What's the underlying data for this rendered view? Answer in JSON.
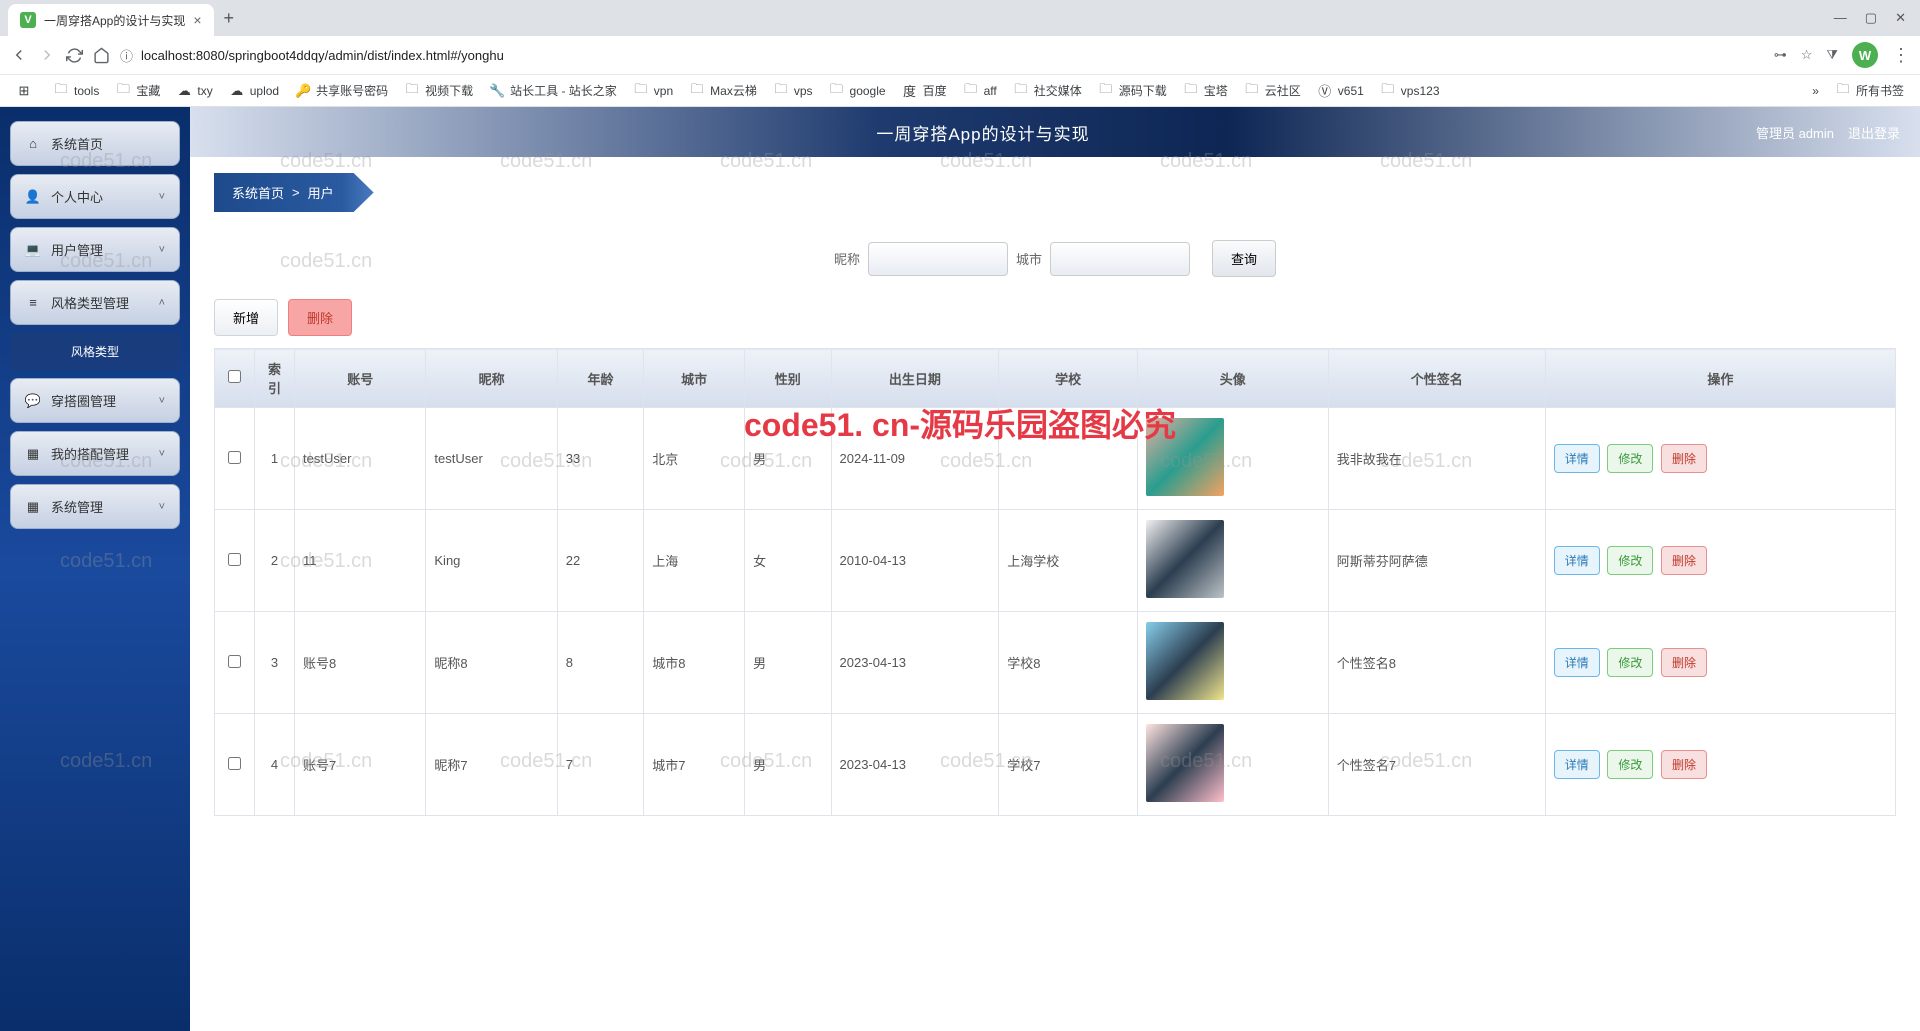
{
  "browser": {
    "tab_title": "一周穿搭App的设计与实现",
    "url": "localhost:8080/springboot4ddqy/admin/dist/index.html#/yonghu",
    "avatar_letter": "W",
    "all_bookmarks": "所有书签",
    "bookmarks": [
      {
        "icon": "apps",
        "label": ""
      },
      {
        "icon": "folder",
        "label": "tools"
      },
      {
        "icon": "folder",
        "label": "宝藏"
      },
      {
        "icon": "cloud",
        "label": "txy"
      },
      {
        "icon": "cloud",
        "label": "uplod"
      },
      {
        "icon": "key",
        "label": "共享账号密码"
      },
      {
        "icon": "folder",
        "label": "视频下载"
      },
      {
        "icon": "tool",
        "label": "站长工具 - 站长之家"
      },
      {
        "icon": "folder",
        "label": "vpn"
      },
      {
        "icon": "folder",
        "label": "Max云梯"
      },
      {
        "icon": "folder",
        "label": "vps"
      },
      {
        "icon": "folder",
        "label": "google"
      },
      {
        "icon": "baidu",
        "label": "百度"
      },
      {
        "icon": "folder",
        "label": "aff"
      },
      {
        "icon": "folder",
        "label": "社交媒体"
      },
      {
        "icon": "folder",
        "label": "源码下载"
      },
      {
        "icon": "folder",
        "label": "宝塔"
      },
      {
        "icon": "folder",
        "label": "云社区"
      },
      {
        "icon": "v",
        "label": "v651"
      },
      {
        "icon": "folder",
        "label": "vps123"
      }
    ]
  },
  "header": {
    "title": "一周穿搭App的设计与实现",
    "admin_label": "管理员 admin",
    "logout_label": "退出登录"
  },
  "sidebar": {
    "items": [
      {
        "icon": "home",
        "label": "系统首页",
        "expandable": false
      },
      {
        "icon": "person",
        "label": "个人中心",
        "expandable": true
      },
      {
        "icon": "laptop",
        "label": "用户管理",
        "expandable": true
      },
      {
        "icon": "style",
        "label": "风格类型管理",
        "expandable": true,
        "expanded": true
      },
      {
        "icon": "chat",
        "label": "穿搭圈管理",
        "expandable": true
      },
      {
        "icon": "grid",
        "label": "我的搭配管理",
        "expandable": true
      },
      {
        "icon": "grid",
        "label": "系统管理",
        "expandable": true
      }
    ],
    "submenu_label": "风格类型"
  },
  "breadcrumb": {
    "home": "系统首页",
    "current": "用户"
  },
  "filter": {
    "nickname_label": "昵称",
    "city_label": "城市",
    "query_label": "查询"
  },
  "actions": {
    "add_label": "新增",
    "delete_label": "删除"
  },
  "table": {
    "headers": {
      "index": "索引",
      "account": "账号",
      "nickname": "昵称",
      "age": "年龄",
      "city": "城市",
      "gender": "性别",
      "birthday": "出生日期",
      "school": "学校",
      "avatar": "头像",
      "signature": "个性签名",
      "operate": "操作"
    },
    "row_actions": {
      "detail": "详情",
      "edit": "修改",
      "delete": "删除"
    },
    "rows": [
      {
        "idx": "1",
        "account": "testUser",
        "nickname": "testUser",
        "age": "33",
        "city": "北京",
        "gender": "男",
        "birthday": "2024-11-09",
        "school": "",
        "signature": "我非故我在"
      },
      {
        "idx": "2",
        "account": "11",
        "nickname": "King",
        "age": "22",
        "city": "上海",
        "gender": "女",
        "birthday": "2010-04-13",
        "school": "上海学校",
        "signature": "阿斯蒂芬阿萨德"
      },
      {
        "idx": "3",
        "account": "账号8",
        "nickname": "昵称8",
        "age": "8",
        "city": "城市8",
        "gender": "男",
        "birthday": "2023-04-13",
        "school": "学校8",
        "signature": "个性签名8"
      },
      {
        "idx": "4",
        "account": "账号7",
        "nickname": "昵称7",
        "age": "7",
        "city": "城市7",
        "gender": "男",
        "birthday": "2023-04-13",
        "school": "学校7",
        "signature": "个性签名7"
      }
    ]
  },
  "watermark": {
    "text": "code51.cn",
    "main": "code51. cn-源码乐园盗图必究"
  }
}
